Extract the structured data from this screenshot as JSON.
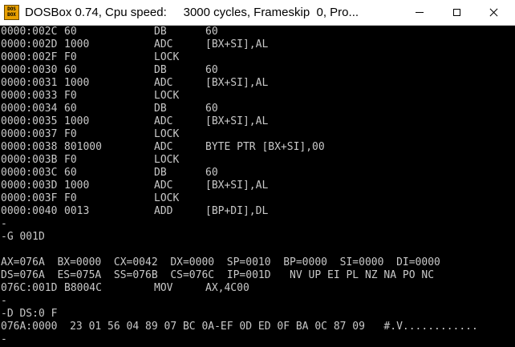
{
  "window": {
    "title": "DOSBox 0.74, Cpu speed:     3000 cycles, Frameskip  0, Pro...",
    "icon": "dosbox-icon",
    "icon_text": "DOS\nBOX",
    "controls": [
      "minimize-icon",
      "maximize-icon",
      "close-icon"
    ]
  },
  "colors": {
    "screen_bg": "#000000",
    "text": "#c8c8c8",
    "titlebar_bg": "#ffffff"
  },
  "disassembly": [
    {
      "addr": "0000:002C",
      "bytes": "60",
      "mnem": "DB",
      "ops": "60"
    },
    {
      "addr": "0000:002D",
      "bytes": "1000",
      "mnem": "ADC",
      "ops": "[BX+SI],AL"
    },
    {
      "addr": "0000:002F",
      "bytes": "F0",
      "mnem": "LOCK",
      "ops": ""
    },
    {
      "addr": "0000:0030",
      "bytes": "60",
      "mnem": "DB",
      "ops": "60"
    },
    {
      "addr": "0000:0031",
      "bytes": "1000",
      "mnem": "ADC",
      "ops": "[BX+SI],AL"
    },
    {
      "addr": "0000:0033",
      "bytes": "F0",
      "mnem": "LOCK",
      "ops": ""
    },
    {
      "addr": "0000:0034",
      "bytes": "60",
      "mnem": "DB",
      "ops": "60"
    },
    {
      "addr": "0000:0035",
      "bytes": "1000",
      "mnem": "ADC",
      "ops": "[BX+SI],AL"
    },
    {
      "addr": "0000:0037",
      "bytes": "F0",
      "mnem": "LOCK",
      "ops": ""
    },
    {
      "addr": "0000:0038",
      "bytes": "801000",
      "mnem": "ADC",
      "ops": "BYTE PTR [BX+SI],00"
    },
    {
      "addr": "0000:003B",
      "bytes": "F0",
      "mnem": "LOCK",
      "ops": ""
    },
    {
      "addr": "0000:003C",
      "bytes": "60",
      "mnem": "DB",
      "ops": "60"
    },
    {
      "addr": "0000:003D",
      "bytes": "1000",
      "mnem": "ADC",
      "ops": "[BX+SI],AL"
    },
    {
      "addr": "0000:003F",
      "bytes": "F0",
      "mnem": "LOCK",
      "ops": ""
    },
    {
      "addr": "0000:0040",
      "bytes": "0013",
      "mnem": "ADD",
      "ops": "[BP+DI],DL"
    }
  ],
  "prompt1": "-",
  "go_command": "-G 001D",
  "registers_line1": "AX=076A  BX=0000  CX=0042  DX=0000  SP=0010  BP=0000  SI=0000  DI=0000",
  "registers_line2": "DS=076A  ES=075A  SS=076B  CS=076C  IP=001D   NV UP EI PL NZ NA PO NC",
  "current_instruction": {
    "addr": "076C:001D",
    "bytes": "B8004C",
    "mnem": "MOV",
    "ops": "AX,4C00"
  },
  "prompt2": "-",
  "dump_command": "-D DS:0 F",
  "dump_line": "076A:0000  23 01 56 04 89 07 BC 0A-EF 0D ED 0F BA 0C 87 09   #.V............",
  "cursor_prompt": "-"
}
